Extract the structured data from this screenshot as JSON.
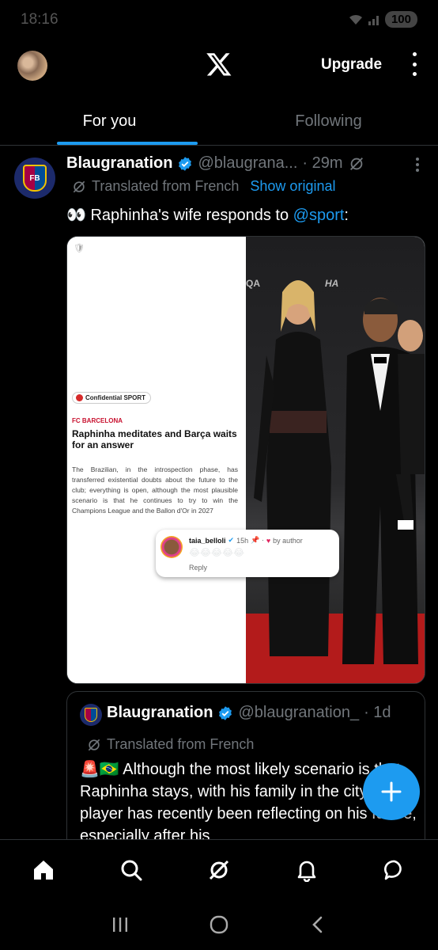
{
  "status_bar": {
    "time": "18:16",
    "battery": "100"
  },
  "header": {
    "upgrade_label": "Upgrade",
    "logo": "x-logo"
  },
  "tabs": [
    {
      "label": "For you",
      "active": true
    },
    {
      "label": "Following",
      "active": false
    }
  ],
  "tweet": {
    "display_name": "Blaugranation",
    "handle": "@blaugrana...",
    "time": "· 29m",
    "translated_label": "Translated from French",
    "show_original": "Show original",
    "text_prefix": "👀 Raphinha's wife responds to ",
    "mention": "@sport",
    "text_suffix": ":",
    "media": {
      "badge": "Confidential SPORT",
      "section": "FC BARCELONA",
      "headline": "Raphinha meditates and Barça waits for an answer",
      "body": "The Brazilian, in the introspection phase, has transferred existential doubts about the future to the club; everything is open, although the most plausible scenario is that he continues to try to win the Champions League and the Ballon d'Or in 2027",
      "sponsor_1": "QA",
      "sponsor_2": "HA",
      "comment": {
        "user": "taia_belloli",
        "meta": "15h",
        "liked_by": "by author",
        "emoji": "😂😂😂😂😂",
        "reply": "Reply"
      }
    }
  },
  "quote": {
    "display_name": "Blaugranation",
    "handle": "@blaugranation_",
    "time": "· 1d",
    "translated_label": "Translated from French",
    "text": "🚨🇧🇷 Although the most likely scenario is that Raphinha stays, with his family in the city, the player has recently been reflecting on his future, especially after his"
  },
  "colors": {
    "accent": "#1d9bf0",
    "background": "#000000",
    "muted": "#71767b"
  }
}
